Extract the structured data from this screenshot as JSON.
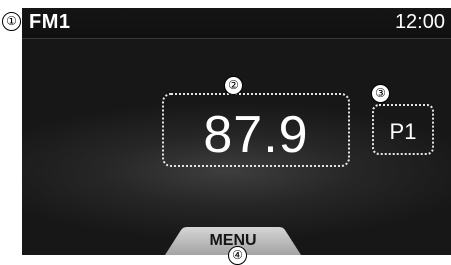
{
  "header": {
    "band": "FM1",
    "time": "12:00"
  },
  "tuner": {
    "frequency": "87.9",
    "preset": "P1"
  },
  "menu": {
    "label": "MENU"
  },
  "callouts": [
    "①",
    "②",
    "③",
    "④"
  ],
  "colors": {
    "screen_background": "#1c1c1c",
    "text": "#ffffff",
    "menu_tab": "#b9b9b9"
  }
}
